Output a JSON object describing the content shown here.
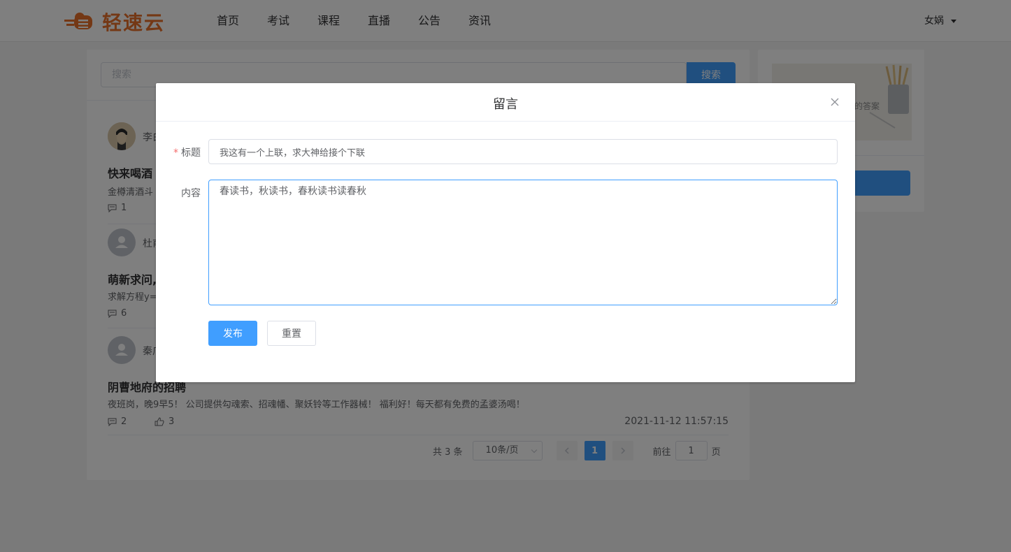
{
  "header": {
    "logo_text": "轻速云",
    "brand_color": "#e8702a",
    "nav": [
      "首页",
      "考试",
      "课程",
      "直播",
      "公告",
      "资讯"
    ],
    "user_name": "女娲"
  },
  "search": {
    "placeholder": "搜索",
    "button_label": "搜索"
  },
  "posts": [
    {
      "author": "李白",
      "title": "快来喝酒",
      "excerpt": "金樽清酒斗",
      "comments": "1",
      "likes": "",
      "time": ""
    },
    {
      "author": "杜甫",
      "title": "萌新求问,",
      "excerpt": "求解方程y=",
      "comments": "6",
      "likes": "",
      "time": ""
    },
    {
      "author": "秦广",
      "title": "阴曹地府的招聘",
      "excerpt": "夜班岗，晚9早5！ 公司提供勾魂索、招魂幡、聚妖铃等工作器械！ 福利好！每天都有免费的孟婆汤喝！",
      "comments": "2",
      "likes": "3",
      "time": "2021-11-12 11:57:15"
    }
  ],
  "pagination": {
    "total": "共 3 条",
    "page_size": "10条/页",
    "current_page": "1",
    "goto_prefix": "前往",
    "goto_value": "1",
    "goto_suffix": "页"
  },
  "side": {
    "image_caption": "的答案"
  },
  "dialog": {
    "title": "留言",
    "title_label": "标题",
    "title_required_mark": "*",
    "title_value": "我这有一个上联，求大神给接个下联",
    "content_label": "内容",
    "content_value": "春读书，秋读书，春秋读书读春秋",
    "publish_label": "发布",
    "reset_label": "重置"
  },
  "colors": {
    "primary": "#409eff",
    "required": "#f56c6c"
  }
}
